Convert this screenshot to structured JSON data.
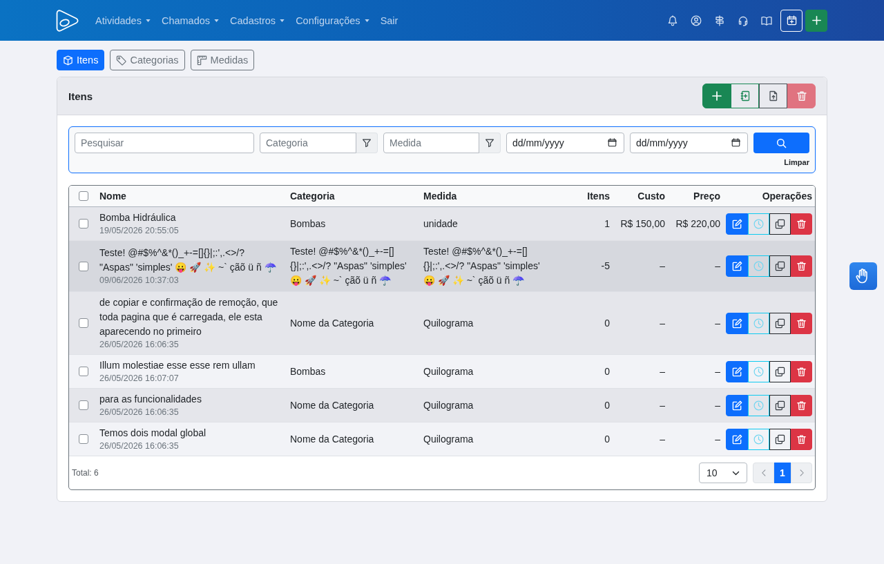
{
  "navbar": {
    "menu": [
      {
        "label": "Atividades",
        "dropdown": true
      },
      {
        "label": "Chamados",
        "dropdown": true
      },
      {
        "label": "Cadastros",
        "dropdown": true
      },
      {
        "label": "Configurações",
        "dropdown": true
      },
      {
        "label": "Sair",
        "dropdown": false
      }
    ]
  },
  "tabs": [
    {
      "label": "Itens",
      "selected": true
    },
    {
      "label": "Categorias",
      "selected": false
    },
    {
      "label": "Medidas",
      "selected": false
    }
  ],
  "card": {
    "title": "Itens",
    "actions": [
      {
        "kind": "add",
        "disabled": false
      },
      {
        "kind": "import",
        "disabled": false
      },
      {
        "kind": "export",
        "disabled": false
      },
      {
        "kind": "delete",
        "disabled": true
      }
    ]
  },
  "filters": {
    "search": {
      "placeholder": "Pesquisar"
    },
    "category": {
      "placeholder": "Categoria"
    },
    "measure": {
      "placeholder": "Medida"
    },
    "date_from": {
      "placeholder": "dd/mm/yyyy"
    },
    "date_to": {
      "placeholder": "dd/mm/yyyy"
    },
    "clear_link": "Limpar"
  },
  "table": {
    "select_all_checked": false,
    "columns": [
      {
        "label": "Nome"
      },
      {
        "label": "Categoria"
      },
      {
        "label": "Medida"
      },
      {
        "label": "Itens"
      },
      {
        "label": "Custo"
      },
      {
        "label": "Preço"
      },
      {
        "label": "Operações"
      }
    ],
    "rows": [
      {
        "name": "Bomba Hidráulica",
        "date": "19/05/2026 20:55:05",
        "category": "Bombas",
        "measure": "unidade",
        "items": "1",
        "cost": "R$ 150,00",
        "price": "R$ 220,00",
        "checked": false,
        "hovered": false
      },
      {
        "name": "Teste! @#$%^&*()_+-=[]{}|;:',.<>/? \"Aspas\" 'simples' 😛 🚀 ✨ ~` çãõ ü ñ ☂️",
        "date": "09/06/2026 10:37:03",
        "category": "Teste! @#$%^&*()_+-=[]{}|;:',.<>/? \"Aspas\" 'simples' 😛 🚀 ✨ ~` çãõ ü ñ ☂️",
        "measure": "Teste! @#$%^&*()_+-=[]{}|;:',.<>/? \"Aspas\" 'simples' 😛 🚀 ✨ ~` çãõ ü ñ ☂️",
        "items": "-5",
        "cost": "–",
        "price": "–",
        "checked": false,
        "hovered": true
      },
      {
        "name": "de copiar e confirmação de remoção, que toda pagina que é carregada, ele esta aparecendo no primeiro",
        "date": "26/05/2026 16:06:35",
        "category": "Nome da Categoria",
        "measure": "Quilograma",
        "items": "0",
        "cost": "–",
        "price": "–",
        "checked": false,
        "hovered": false
      },
      {
        "name": "Illum molestiae esse esse rem ullam",
        "date": "26/05/2026 16:07:07",
        "category": "Bombas",
        "measure": "Quilograma",
        "items": "0",
        "cost": "–",
        "price": "–",
        "checked": false,
        "hovered": false
      },
      {
        "name": "para as funcionalidades",
        "date": "26/05/2026 16:06:35",
        "category": "Nome da Categoria",
        "measure": "Quilograma",
        "items": "0",
        "cost": "–",
        "price": "–",
        "checked": false,
        "hovered": false
      },
      {
        "name": "Temos dois modal global",
        "date": "26/05/2026 16:06:35",
        "category": "Nome da Categoria",
        "measure": "Quilograma",
        "items": "0",
        "cost": "–",
        "price": "–",
        "checked": false,
        "hovered": false
      }
    ],
    "total": "Total: 6",
    "page_size": "10",
    "pages": [
      {
        "label": "1",
        "selected": true
      }
    ]
  }
}
